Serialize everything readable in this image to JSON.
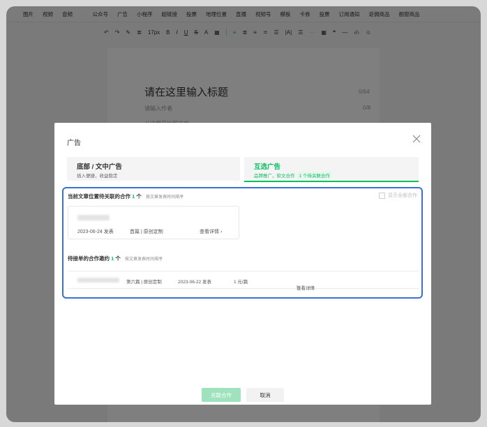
{
  "menu": [
    "图片",
    "视频",
    "音频",
    "公众号",
    "广告",
    "小程序",
    "超链接",
    "投票",
    "地理位置",
    "直播",
    "视频号",
    "模板",
    "卡券",
    "投票",
    "订阅通知",
    "返佣商品",
    "橱窗商品"
  ],
  "toolbar": {
    "font_size": "17px",
    "items": [
      "↶",
      "↷",
      "✎",
      "≣",
      "B",
      "I",
      "U",
      "S",
      "A",
      "▦",
      "≡",
      "≣",
      "≡",
      "≐",
      "☰",
      "|A|",
      "☰",
      "⋯",
      "▦",
      "❝",
      "—",
      "‹/›",
      "☺"
    ]
  },
  "editor": {
    "title_placeholder": "请在这里输入标题",
    "title_count": "0/64",
    "author_placeholder": "请输入作者",
    "author_count": "0/8",
    "body_placeholder": "从这里开始写正文"
  },
  "modal": {
    "title": "广告",
    "tab1": {
      "label": "底部 / 文中广告",
      "sub": "插入便捷，收益稳定"
    },
    "tab2": {
      "label": "互选广告",
      "sub": "品牌推广，软文合作",
      "badge": "1 个待关联合作"
    },
    "section1": {
      "prefix": "当前文章位置待关联的合作",
      "count": "1",
      "suffix": "个",
      "note": "按文章发表时间排序"
    },
    "show_all": "显示全部合作",
    "card": {
      "date": "2023-06-24 发表",
      "meta": "首篇 | 原创定制",
      "detail": "查看详情"
    },
    "section2": {
      "prefix": "待接单的合作邀约",
      "count": "1",
      "suffix": "个",
      "note": "按文章发表时间排序"
    },
    "row": {
      "meta": "第六篇 | 原创定制",
      "date": "2023-06-22 发表",
      "price": "1 元/篇",
      "detail": "查看详情"
    },
    "confirm": "关联合作",
    "cancel": "取消"
  }
}
